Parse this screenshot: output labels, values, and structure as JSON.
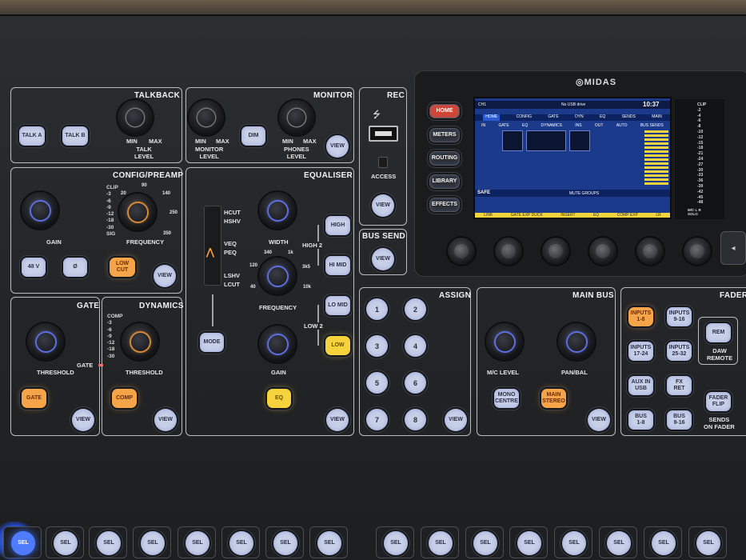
{
  "brand": "MIDAS",
  "talkback": {
    "title": "TALKBACK",
    "talk_a": "TALK A",
    "talk_b": "TALK B",
    "min": "MIN",
    "max": "MAX",
    "knob_label": "TALK\nLEVEL"
  },
  "monitor": {
    "title": "MONITOR",
    "dim": "DIM",
    "view": "VIEW",
    "min": "MIN",
    "max": "MAX",
    "monitor_level": "MONITOR\nLEVEL",
    "phones_level": "PHONES\nLEVEL"
  },
  "rec": {
    "title": "REC",
    "access": "ACCESS",
    "view": "VIEW"
  },
  "bus_send": {
    "title": "BUS SEND",
    "view": "VIEW"
  },
  "config_preamp": {
    "title": "CONFIG/PREAMP",
    "gain": "GAIN",
    "frequency": "FREQUENCY",
    "meter_labels": [
      "CLIP",
      "-3",
      "-6",
      "-9",
      "-12",
      "-18",
      "-30",
      "SIG"
    ],
    "freq_scale": [
      "20",
      "90",
      "140",
      "250",
      "350"
    ],
    "btn_48v": "48 V",
    "btn_phase": "Ø",
    "btn_low_cut": "LOW\nCUT",
    "view": "VIEW"
  },
  "equaliser": {
    "title": "EQUALISER",
    "modes": [
      "HCUT",
      "HSHV",
      "VEQ",
      "PEQ",
      "LSHV",
      "LCUT"
    ],
    "mode": "MODE",
    "width": "WIDTH",
    "frequency": "FREQUENCY",
    "freq_scale": [
      "120",
      "340",
      "1k",
      "3k5",
      "40",
      "10k"
    ],
    "gain": "GAIN",
    "high2": "HIGH 2",
    "low2": "LOW 2",
    "high": "HIGH",
    "hi_mid": "HI MID",
    "lo_mid": "LO MID",
    "low": "LOW",
    "eq": "EQ",
    "view": "VIEW"
  },
  "gate": {
    "title": "GATE",
    "threshold": "THRESHOLD",
    "gate_led": "GATE",
    "gate_btn": "GATE",
    "view": "VIEW"
  },
  "dynamics": {
    "title": "DYNAMICS",
    "meter_labels": [
      "COMP",
      "-3",
      "-6",
      "-9",
      "-12",
      "-18",
      "-30"
    ],
    "threshold": "THRESHOLD",
    "comp": "COMP",
    "view": "VIEW"
  },
  "assign": {
    "title": "ASSIGN",
    "buttons": [
      "1",
      "2",
      "3",
      "4",
      "5",
      "6",
      "7",
      "8"
    ],
    "view": "VIEW"
  },
  "main_bus": {
    "title": "MAIN BUS",
    "mc_level": "M/C LEVEL",
    "pan_bal": "PAN/BAL",
    "mono_centre": "MONO\nCENTRE",
    "main_stereo": "MAIN\nSTEREO",
    "view": "VIEW"
  },
  "fader": {
    "title": "FADER",
    "buttons": [
      "INPUTS\n1-8",
      "INPUTS\n9-16",
      "INPUTS\n17-24",
      "INPUTS\n25-32",
      "AUX IN\nUSB",
      "FX\nRET",
      "BUS\n1-8",
      "BUS\n9-16"
    ],
    "rem": "REM",
    "daw_remote": "DAW\nREMOTE",
    "fader_flip": "FADER\nFLIP",
    "sends_on_fader": "SENDS\nON FADER"
  },
  "screen_buttons": [
    "HOME",
    "METERS",
    "ROUTING",
    "LIBRARY",
    "EFFECTS"
  ],
  "lcd": {
    "channel": "CH1",
    "usb": "No USB drive",
    "time": "10:37",
    "tabs": [
      "HOME",
      "CONFIG",
      "GATE",
      "DYN",
      "EQ",
      "SENDS",
      "MAIN"
    ],
    "sub_labels": [
      "IN",
      "GATE",
      "EQ",
      "DYNAMICS",
      "INS",
      "OUT",
      "AUTO",
      "BUS SENDS"
    ],
    "safe": "SAFE",
    "mute_groups": "MUTE GROUPS",
    "bottom": [
      "LINK",
      "GATE EXP DUCK",
      "INSERT",
      "EQ",
      "COMP EXP",
      "LR"
    ]
  },
  "meter_bridge": {
    "labels": [
      "CLIP",
      "-2",
      "-4",
      "-6",
      "-8",
      "-10",
      "-12",
      "-15",
      "-18",
      "-21",
      "-24",
      "-27",
      "-30",
      "-33",
      "-36",
      "-39",
      "-42",
      "-45",
      "-48"
    ],
    "footer": [
      "M/C",
      "SOLO",
      "L",
      "R"
    ]
  },
  "sel_label": "SEL",
  "sel_count_left": 8,
  "sel_count_right": 8
}
